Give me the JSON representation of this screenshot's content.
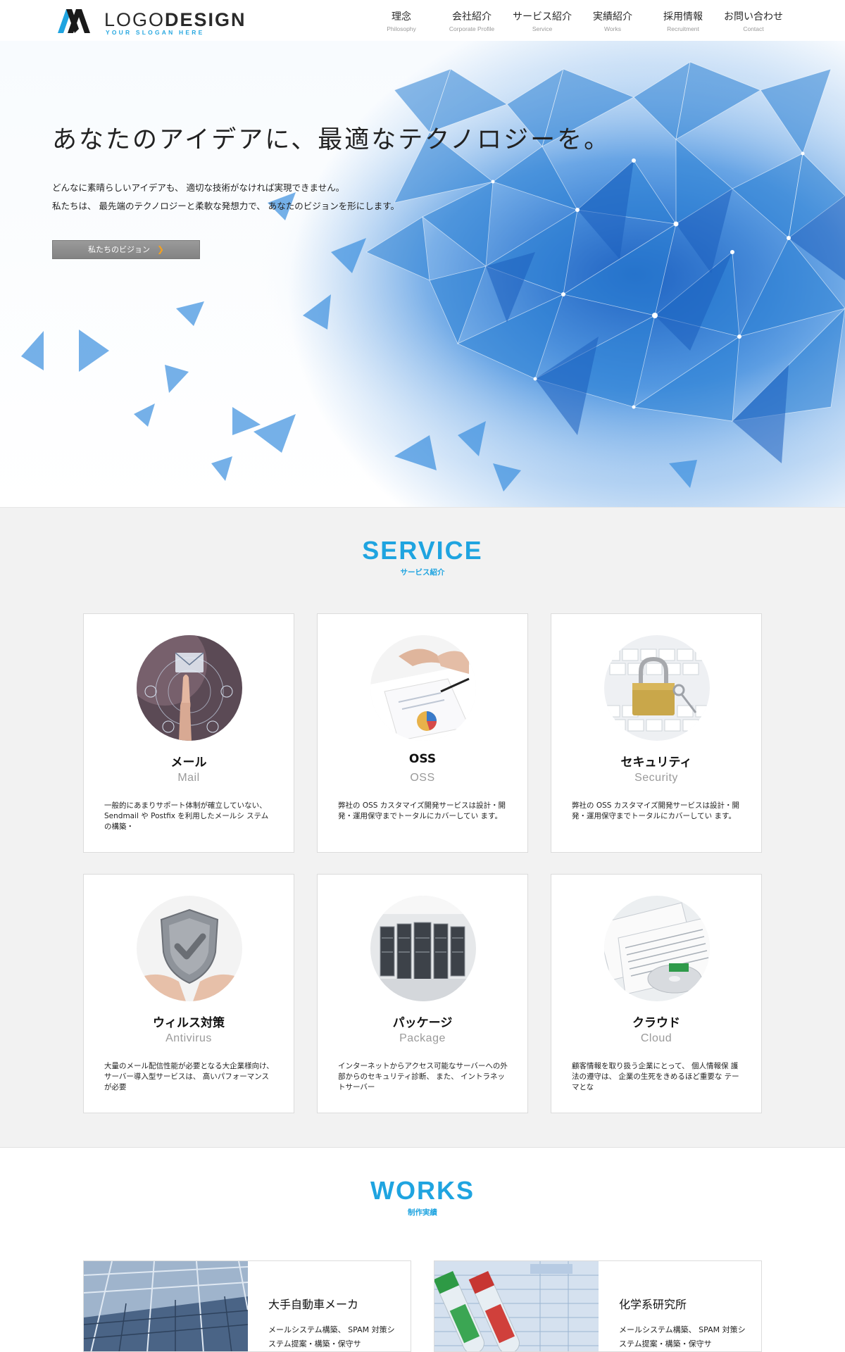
{
  "brand": {
    "logo_thin": "LOGO",
    "logo_bold": "DESIGN",
    "slogan": "YOUR SLOGAN HERE",
    "accent": "#1fa4e0"
  },
  "nav": [
    {
      "jp": "理念",
      "en": "Philosophy"
    },
    {
      "jp": "会社紹介",
      "en": "Corporate Profile"
    },
    {
      "jp": "サービス紹介",
      "en": "Service"
    },
    {
      "jp": "実績紹介",
      "en": "Works"
    },
    {
      "jp": "採用情報",
      "en": "Recruitment"
    },
    {
      "jp": "お問い合わせ",
      "en": "Contact"
    }
  ],
  "hero": {
    "title": "あなたのアイデアに、最適なテクノロジーを。",
    "line1": "どんなに素晴らしいアイデアも、 適切な技術がなければ実現できません。",
    "line2": "私たちは、 最先端のテクノロジーと柔軟な発想力で、 あなたのビジョンを形にします。",
    "button": "私たちのビジョン",
    "button_icon": "chevron-right-icon"
  },
  "service": {
    "title": "SERVICE",
    "subtitle": "サービス紹介",
    "cards": [
      {
        "title": "メール",
        "en": "Mail",
        "desc": "一般的にあまりサポート体制が確立していない、 Sendmail や Postfix を利用したメールシ ステムの構築・",
        "image": "email-touch"
      },
      {
        "title": "OSS",
        "en": "OSS",
        "desc": "弊社の OSS カスタマイズ開発サービスは設計・開発・運用保守までトータルにカバーしてい ます。",
        "image": "meeting-hands"
      },
      {
        "title": "セキュリティ",
        "en": "Security",
        "desc": "弊社の OSS カスタマイズ開発サービスは設計・開発・運用保守までトータルにカバーしてい ます。",
        "image": "padlock-keyboard"
      },
      {
        "title": "ウィルス対策",
        "en": "Antivirus",
        "desc": "大量のメール配信性能が必要となる大企業様向け、 サーバー導入型サービスは、 高いパフォーマンスが必要",
        "image": "shield-check"
      },
      {
        "title": "パッケージ",
        "en": "Package",
        "desc": "インターネットからアクセス可能なサーバーへの外部からのセキュリティ診断、 また、 イントラネットサーバー",
        "image": "server-room"
      },
      {
        "title": "クラウド",
        "en": "Cloud",
        "desc": "顧客情報を取り扱う企業にとって、 個人情報保 護法の遵守は、 企業の生死をきめるほど重要な テーマとな",
        "image": "documents-disc"
      }
    ]
  },
  "works": {
    "title": "WORKS",
    "subtitle": "制作実績",
    "items": [
      {
        "title": "大手自動車メーカ",
        "desc": "メールシステム構築、 SPAM 対策システム提案・構築・保守サ",
        "image": "factory-hall"
      },
      {
        "title": "化学系研究所",
        "desc": "メールシステム構築、 SPAM 対策システム提案・構築・保守サ",
        "image": "test-tubes"
      }
    ]
  }
}
